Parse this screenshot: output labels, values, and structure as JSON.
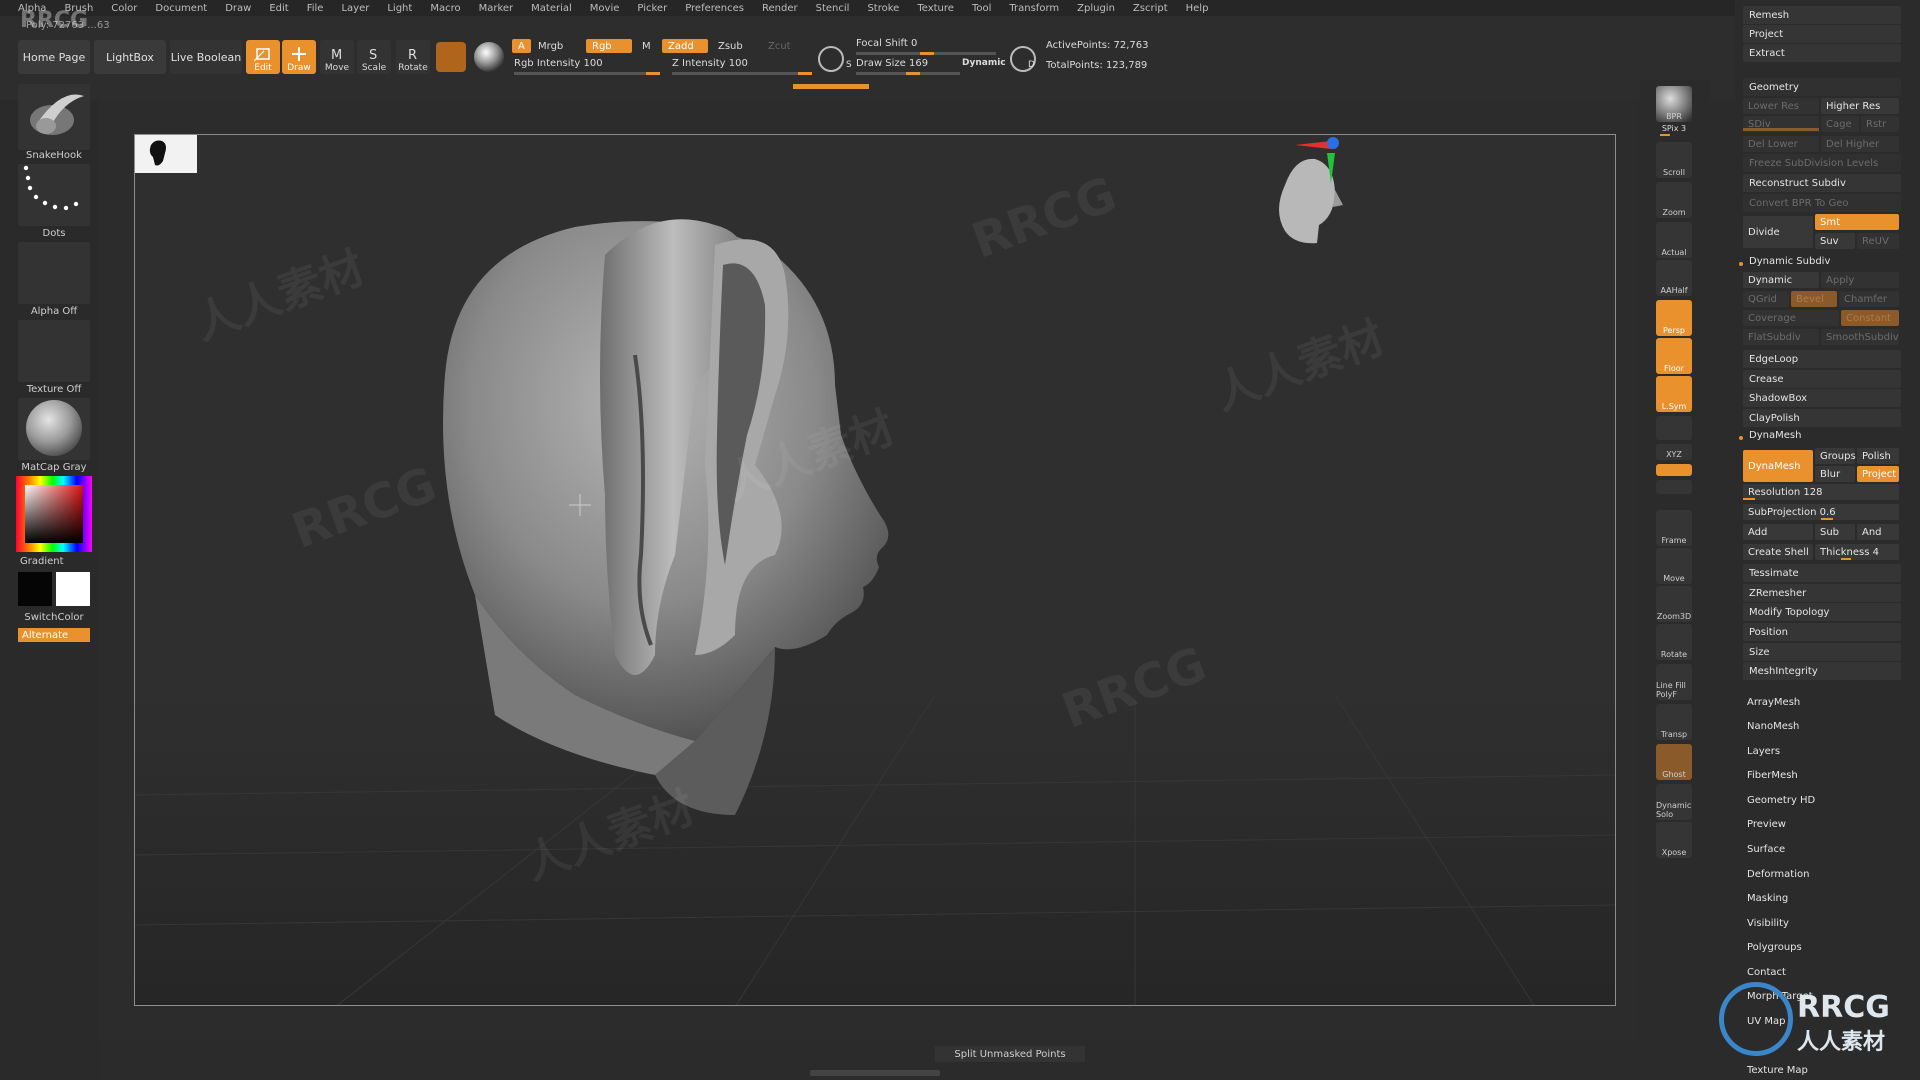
{
  "menu": [
    "Alpha",
    "Brush",
    "Color",
    "Document",
    "Draw",
    "Edit",
    "File",
    "Layer",
    "Light",
    "Macro",
    "Marker",
    "Material",
    "Movie",
    "Picker",
    "Preferences",
    "Render",
    "Stencil",
    "Stroke",
    "Texture",
    "Tool",
    "Transform",
    "Zplugin",
    "Zscript",
    "Help"
  ],
  "shelf": {
    "stats": "Poly: 72763  ...63",
    "home_page": "Home Page",
    "lightbox": "LightBox",
    "live_boolean": "Live Boolean",
    "tools": [
      {
        "label": "Edit",
        "active": true
      },
      {
        "label": "Draw",
        "active": true
      },
      {
        "label": "Move",
        "active": false
      },
      {
        "label": "Scale",
        "active": false
      },
      {
        "label": "Rotate",
        "active": false
      }
    ],
    "a_label": "A",
    "mrgb": "Mrgb",
    "rgb": "Rgb",
    "m": "M",
    "zadd": "Zadd",
    "zsub": "Zsub",
    "zcut": "Zcut",
    "rgb_intensity": "Rgb Intensity 100",
    "z_intensity": "Z Intensity 100",
    "focal_shift": "Focal Shift 0",
    "draw_size": "Draw Size 169",
    "dynamic": "Dynamic",
    "s_label": "S",
    "d_label": "D",
    "active_points": "ActivePoints: 72,763",
    "total_points": "TotalPoints: 123,789"
  },
  "left_tray": {
    "brush": "SnakeHook",
    "stroke": "Dots",
    "alpha": "Alpha Off",
    "texture": "Texture Off",
    "material": "MatCap Gray",
    "gradient": "Gradient",
    "switch_color": "SwitchColor",
    "alternate": "Alternate"
  },
  "right_strip": [
    "BPR",
    "SPix 3",
    "Scroll",
    "Zoom",
    "Actual",
    "AAHalf",
    "Persp",
    "Floor",
    "L.Sym",
    "",
    "XYZ",
    "",
    "",
    "Frame",
    "Move",
    "Zoom3D",
    "Rotate",
    "Line Fill PolyF",
    "Transp",
    "Ghost",
    "Dynamic Solo",
    "Xpose"
  ],
  "palette": {
    "top_items": [
      "Remesh",
      "Project",
      "Extract"
    ],
    "geometry_header": "Geometry",
    "lower_res": "Lower Res",
    "higher_res": "Higher Res",
    "sdiv": "SDiv",
    "cage": "Cage",
    "rstr": "Rstr",
    "del_lower": "Del Lower",
    "del_higher": "Del Higher",
    "freeze": "Freeze SubDivision Levels",
    "reconstruct": "Reconstruct Subdiv",
    "convert_bpr": "Convert BPR To Geo",
    "divide": "Divide",
    "smt": "Smt",
    "suv": "Suv",
    "reuv": "ReUV",
    "dynamic_subdiv": "Dynamic Subdiv",
    "dynamic": "Dynamic",
    "apply": "Apply",
    "qgrid": "QGrid",
    "bevel": "Bevel",
    "chamfer": "Chamfer",
    "coverage": "Coverage",
    "constant": "Constant",
    "flat_subdiv": "FlatSubdiv",
    "smooth_subdiv": "SmoothSubdiv",
    "edgeloop": "EdgeLoop",
    "crease": "Crease",
    "shadowbox": "ShadowBox",
    "claypolish": "ClayPolish",
    "dynamesh_header": "DynaMesh",
    "dynamesh_btn": "DynaMesh",
    "groups": "Groups",
    "polish": "Polish",
    "blur": "Blur",
    "project": "Project",
    "resolution": "Resolution 128",
    "subprojection": "SubProjection 0.6",
    "add": "Add",
    "sub": "Sub",
    "and": "And",
    "create_shell": "Create Shell",
    "thickness": "Thickness 4",
    "tessimate": "Tessimate",
    "zremesher": "ZRemesher",
    "modify_topology": "Modify Topology",
    "position": "Position",
    "size": "Size",
    "meshintegrity": "MeshIntegrity",
    "sub_palettes": [
      "ArrayMesh",
      "NanoMesh",
      "Layers",
      "FiberMesh",
      "Geometry HD",
      "Preview",
      "Surface",
      "Deformation",
      "Masking",
      "Visibility",
      "Polygroups",
      "Contact",
      "Morph Target",
      "UV Map",
      "Texture Map"
    ]
  },
  "bottom": {
    "status": "Split Unmasked Points"
  },
  "watermarks": {
    "logo": "RRCG",
    "cn": "人人素材"
  },
  "colors": {
    "accent": "#e8912d",
    "panel": "#2b2b2b",
    "canvas": "#2f2f2f"
  }
}
